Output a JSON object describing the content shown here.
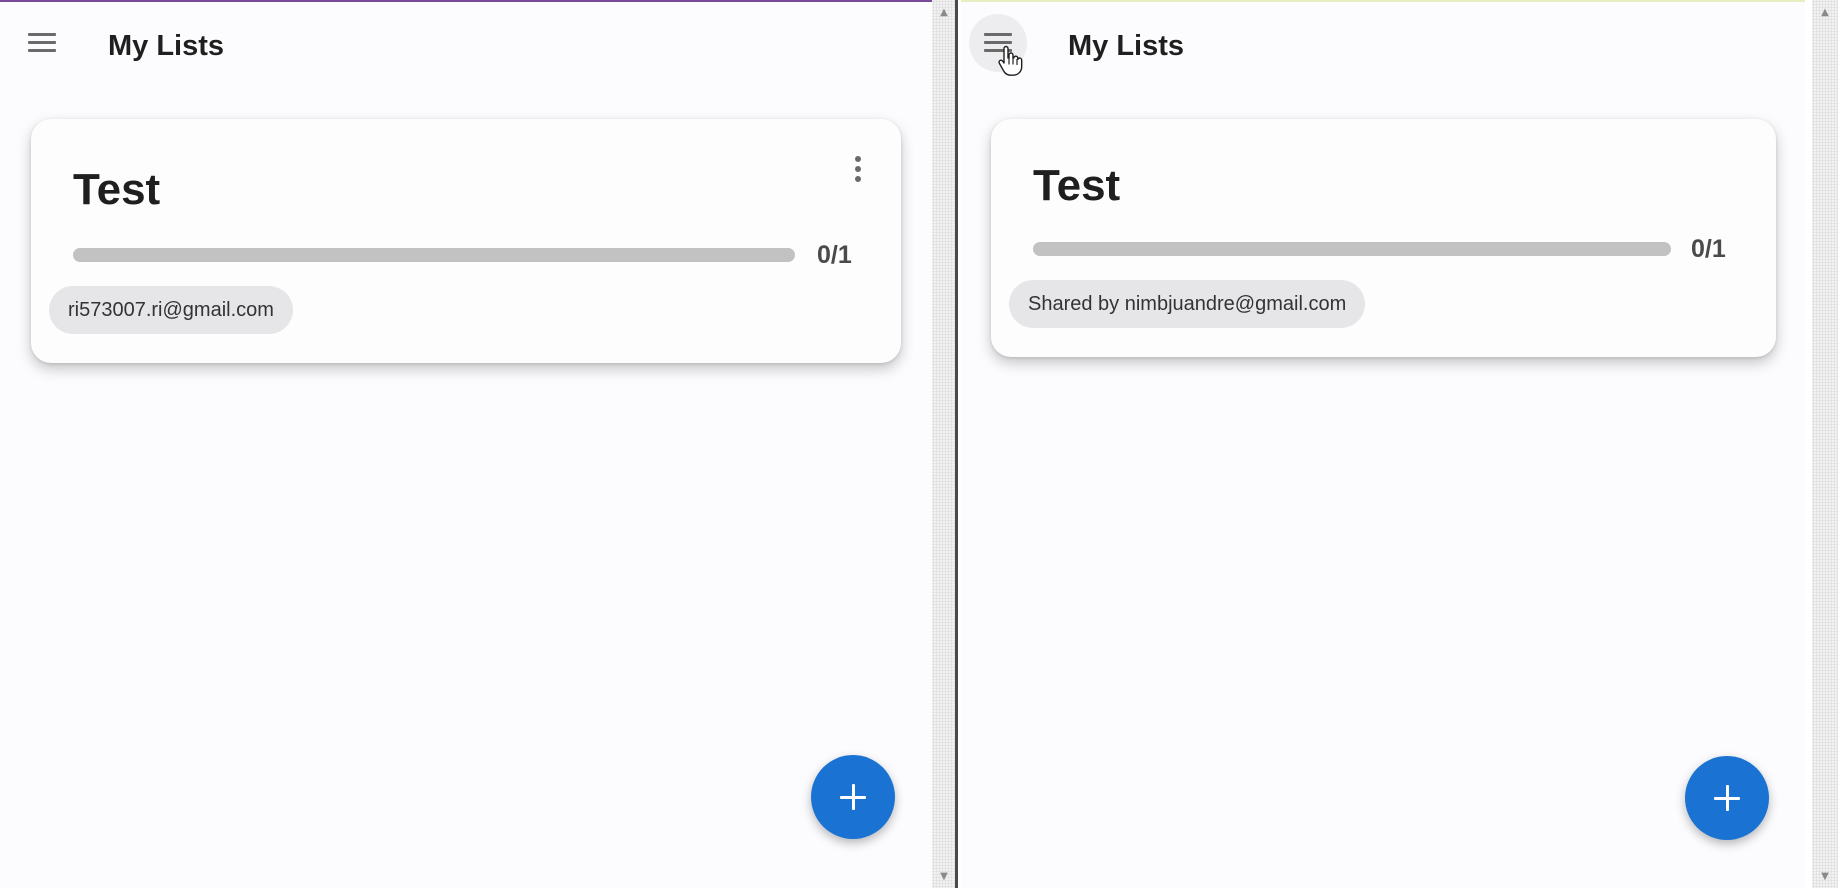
{
  "colors": {
    "accent": "#1a73d3",
    "background": "#fcfcfe",
    "progress_track": "#c2c2c2",
    "chip_background": "#e6e6e8"
  },
  "windows": [
    {
      "app_title": "My Lists",
      "menu_icon": "hamburger-menu-icon",
      "list_card": {
        "title": "Test",
        "progress": {
          "done": 0,
          "total": 1,
          "label": "0/1",
          "fraction": 0
        },
        "chip_text": "ri573007.ri@gmail.com",
        "more_icon": "more-vertical-icon"
      },
      "fab_icon": "plus-icon"
    },
    {
      "app_title": "My Lists",
      "menu_icon": "hamburger-menu-icon",
      "list_card": {
        "title": "Test",
        "progress": {
          "done": 0,
          "total": 1,
          "label": "0/1",
          "fraction": 0
        },
        "chip_text": "Shared by nimbjuandre@gmail.com"
      },
      "fab_icon": "plus-icon",
      "cursor_icon": "hand-pointer-cursor-icon"
    }
  ]
}
